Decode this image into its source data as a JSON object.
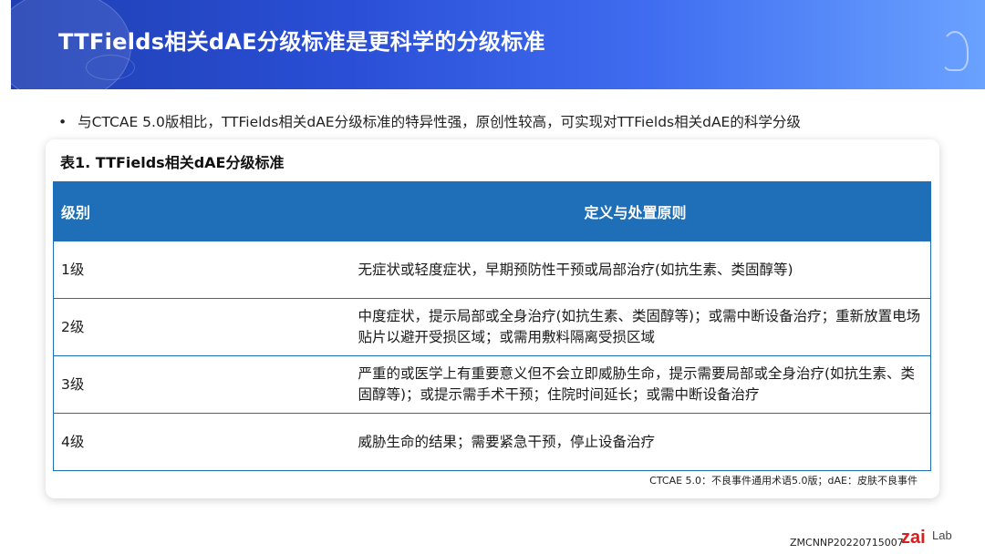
{
  "slide": {
    "title": "TTFields相关dAE分级标准是更科学的分级标准",
    "bullet": "与CTCAE 5.0版相比，TTFields相关dAE分级标准的特异性强，原创性较高，可实现对TTFields相关dAE的科学分级",
    "bullet_marker": "•"
  },
  "table": {
    "caption": "表1. TTFields相关dAE分级标准",
    "headers": {
      "grade": "级别",
      "definition": "定义与处置原则"
    },
    "rows": [
      {
        "grade": "1级",
        "definition": "无症状或轻度症状，早期预防性干预或局部治疗(如抗生素、类固醇等)"
      },
      {
        "grade": "2级",
        "definition": "中度症状，提示局部或全身治疗(如抗生素、类固醇等)；或需中断设备治疗；重新放置电场贴片以避开受损区域；或需用敷料隔离受损区域"
      },
      {
        "grade": "3级",
        "definition": "严重的或医学上有重要意义但不会立即威胁生命，提示需要局部或全身治疗(如抗生素、类固醇等)；或提示需手术干预；住院时间延长；或需中断设备治疗"
      },
      {
        "grade": "4级",
        "definition": "威胁生命的结果；需要紧急干预，停止设备治疗"
      }
    ],
    "footnote": "CTCAE 5.0：不良事件通用术语5.0版；dAE：皮肤不良事件"
  },
  "footer": {
    "doc_code": "ZMCNNP20220715007",
    "logo_text": "zaiLab"
  },
  "colors": {
    "banner_start": "#1f3fb3",
    "banner_end": "#6aa2ff",
    "table_header": "#1e6fb8",
    "logo_red": "#d81e1e"
  }
}
